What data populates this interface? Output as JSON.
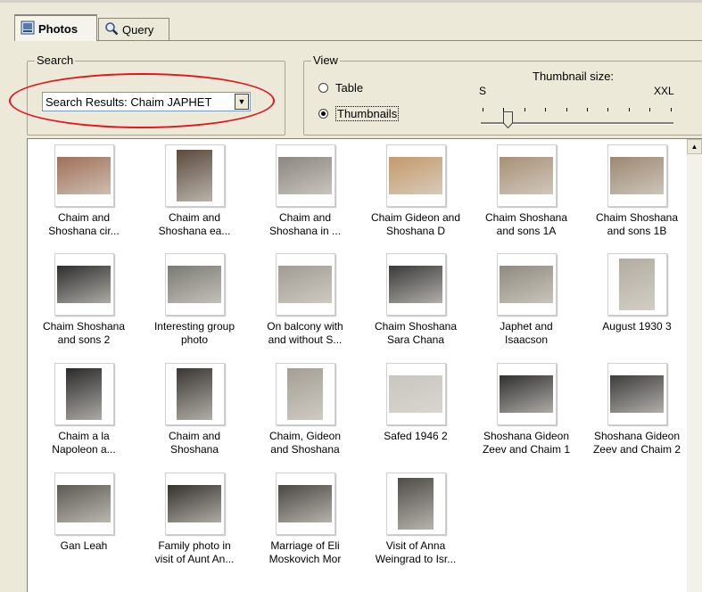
{
  "tabs": [
    {
      "label": "Photos",
      "icon": "photos-icon"
    },
    {
      "label": "Query",
      "icon": "magnifier-icon"
    }
  ],
  "search": {
    "group_label": "Search",
    "selected_value": "Search Results: Chaim JAPHET"
  },
  "view": {
    "group_label": "View",
    "options": [
      "Table",
      "Thumbnails"
    ],
    "selected": "Thumbnails",
    "thumbnail_size_label": "Thumbnail size:",
    "size_min": "S",
    "size_max": "XXL",
    "size_level_fraction": 0.14
  },
  "thumbnails": [
    {
      "line1": "Chaim and",
      "line2": "Shoshana cir...",
      "photo_color": "#a07058"
    },
    {
      "line1": "Chaim and",
      "line2": "Shoshana ea...",
      "photo_color": "#5a4a3c"
    },
    {
      "line1": "Chaim and",
      "line2": "Shoshana in ...",
      "photo_color": "#8c8680"
    },
    {
      "line1": "Chaim Gideon and",
      "line2": "Shoshana D",
      "photo_color": "#c49a6c"
    },
    {
      "line1": "Chaim Shoshana",
      "line2": "and sons 1A",
      "photo_color": "#a89078"
    },
    {
      "line1": "Chaim Shoshana",
      "line2": "and sons 1B",
      "photo_color": "#9c8872"
    },
    {
      "line1": "Chaim Shoshana",
      "line2": "and sons 2",
      "photo_color": "#2e2e2e"
    },
    {
      "line1": "Interesting group",
      "line2": "photo",
      "photo_color": "#7a7a74"
    },
    {
      "line1": "On balcony with",
      "line2": "and without S...",
      "photo_color": "#a09c94"
    },
    {
      "line1": "Chaim Shoshana",
      "line2": "Sara Chana",
      "photo_color": "#3a3a3a"
    },
    {
      "line1": "Japhet and",
      "line2": "Isaacson",
      "photo_color": "#8e8a7e"
    },
    {
      "line1": "August 1930 3",
      "line2": "",
      "photo_color": "#b2aca0"
    },
    {
      "line1": "Chaim a la",
      "line2": "Napoleon a...",
      "photo_color": "#2a2a2a"
    },
    {
      "line1": "Chaim and",
      "line2": "Shoshana",
      "photo_color": "#3a3632"
    },
    {
      "line1": "Chaim, Gideon",
      "line2": "and Shoshana",
      "photo_color": "#a49e94"
    },
    {
      "line1": "Safed 1946 2",
      "line2": "",
      "photo_color": "#c8c6c0"
    },
    {
      "line1": "Shoshana Gideon",
      "line2": "Zeev and Chaim 1",
      "photo_color": "#303030"
    },
    {
      "line1": "Shoshana Gideon",
      "line2": "Zeev and Chaim 2",
      "photo_color": "#3c3c3c"
    },
    {
      "line1": "Gan Leah",
      "line2": "",
      "photo_color": "#5c5a54"
    },
    {
      "line1": "Family photo in",
      "line2": "visit of Aunt An...",
      "photo_color": "#34322e"
    },
    {
      "line1": "Marriage of Eli",
      "line2": "Moskovich Mor",
      "photo_color": "#4a4844"
    },
    {
      "line1": "Visit of Anna",
      "line2": "Weingrad to Isr...",
      "photo_color": "#4e4c48"
    }
  ]
}
